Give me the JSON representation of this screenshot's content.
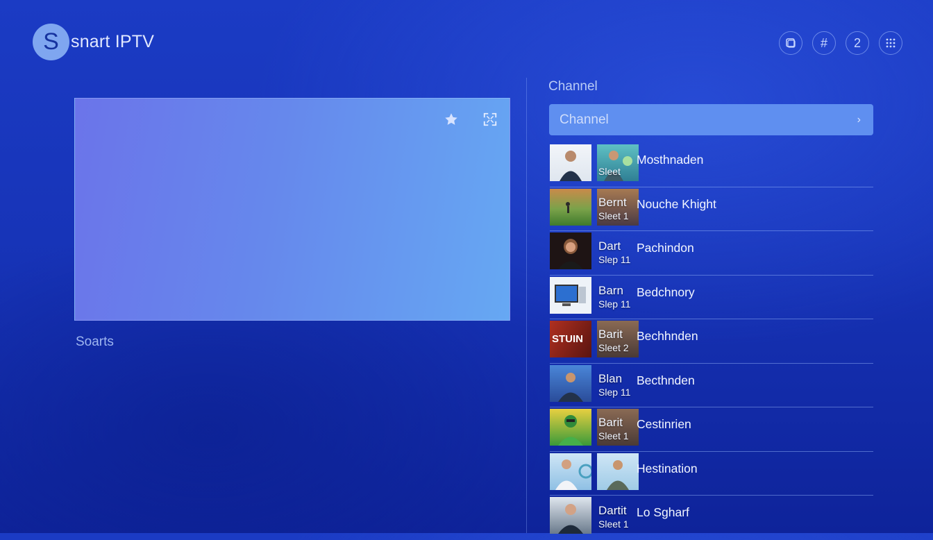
{
  "app": {
    "logo_letter": "S",
    "logo_text": "snart IPTV"
  },
  "top_icons": [
    {
      "name": "screen-icon",
      "glyph": "⧉"
    },
    {
      "name": "grid-hash-icon",
      "glyph": "#"
    },
    {
      "name": "number-badge",
      "glyph": "2"
    },
    {
      "name": "apps-grid-icon",
      "glyph": "⠿"
    }
  ],
  "player": {
    "favorite_icon": "star-icon",
    "fullscreen_icon": "fullscreen-icon"
  },
  "sports_label": "Soarts",
  "channel_panel": {
    "heading": "Channel",
    "select_value": "Channel",
    "rows": [
      {
        "line1": "",
        "line2": "Sleet",
        "name": "Mosthnaden",
        "c1": "#e9eef5",
        "c2": "#4aa0a8"
      },
      {
        "line1": "Bernt",
        "line2": "Sleet 1",
        "name": "Nouche Khight",
        "c1": "#4c7a3a",
        "c2": "#7a5a40"
      },
      {
        "line1": "Dart",
        "line2": "Slep 11",
        "name": "Pachindon",
        "c1": "#2a1c1a",
        "c2": ""
      },
      {
        "line1": "Barn",
        "line2": "Slep 11",
        "name": "Bedchnory",
        "c1": "#d8e2ef",
        "c2": ""
      },
      {
        "line1": "Barit",
        "line2": "Sleet 2",
        "name": "Bechhnden",
        "c1": "#9a2a1c",
        "c2": "#6a4a38"
      },
      {
        "line1": "Blan",
        "line2": "Slep 11",
        "name": "Becthnden",
        "c1": "#3a6cc0",
        "c2": ""
      },
      {
        "line1": "Barit",
        "line2": "Sleet 1",
        "name": "Cestinrien",
        "c1": "#3fa34a",
        "c2": "#6a5240"
      },
      {
        "line1": "",
        "line2": "",
        "name": "Hestination",
        "c1": "#8fc4ea",
        "c2": "#9fcbe6"
      },
      {
        "line1": "Dartit",
        "line2": "Sleet 1",
        "name": "Lo Sgharf",
        "c1": "#5a6a7a",
        "c2": ""
      }
    ]
  }
}
